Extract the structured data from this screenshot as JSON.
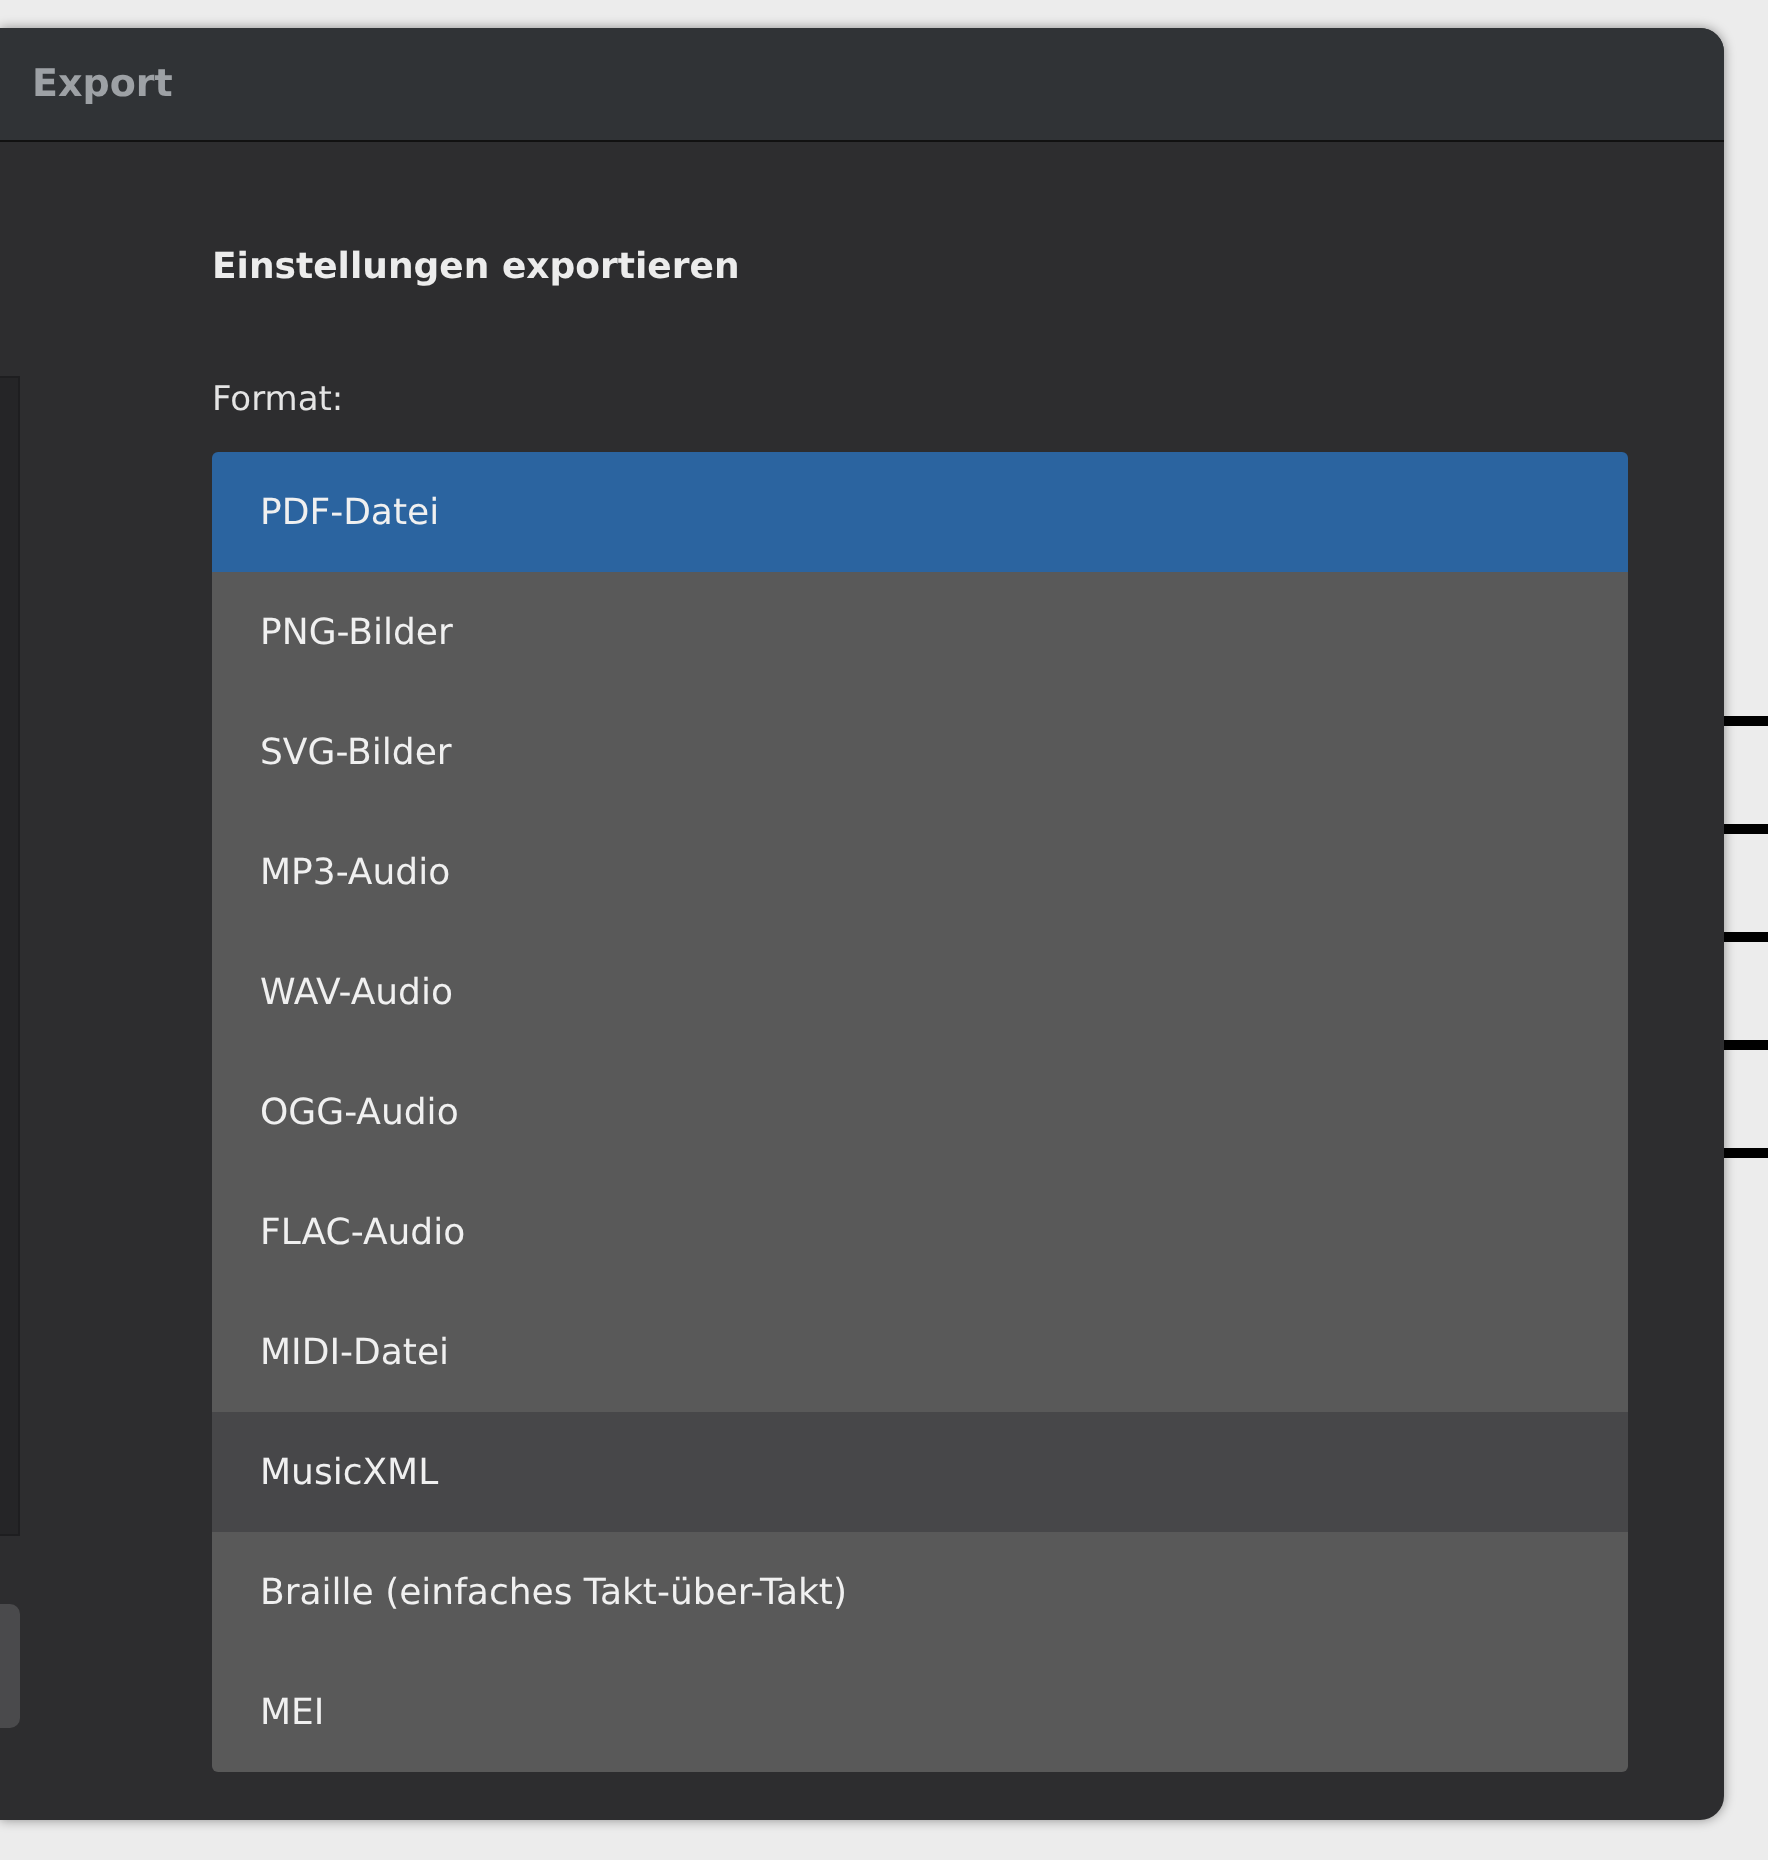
{
  "window": {
    "title": "Export"
  },
  "section": {
    "heading": "Einstellungen exportieren",
    "label": "Format:"
  },
  "formats": [
    {
      "label": "PDF-Datei",
      "selected": true,
      "hovered": false
    },
    {
      "label": "PNG-Bilder",
      "selected": false,
      "hovered": false
    },
    {
      "label": "SVG-Bilder",
      "selected": false,
      "hovered": false
    },
    {
      "label": "MP3-Audio",
      "selected": false,
      "hovered": false
    },
    {
      "label": "WAV-Audio",
      "selected": false,
      "hovered": false
    },
    {
      "label": "OGG-Audio",
      "selected": false,
      "hovered": false
    },
    {
      "label": "FLAC-Audio",
      "selected": false,
      "hovered": false
    },
    {
      "label": "MIDI-Datei",
      "selected": false,
      "hovered": false
    },
    {
      "label": "MusicXML",
      "selected": false,
      "hovered": true
    },
    {
      "label": "Braille (einfaches Takt-über-Takt)",
      "selected": false,
      "hovered": false
    },
    {
      "label": "MEI",
      "selected": false,
      "hovered": false
    }
  ]
}
